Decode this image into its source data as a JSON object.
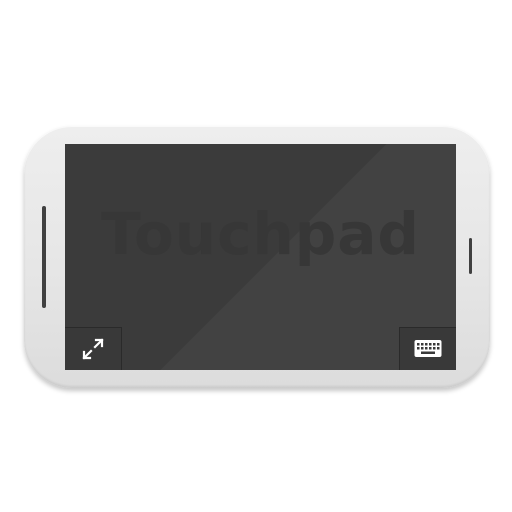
{
  "touchpad": {
    "watermark": "Touchpad"
  },
  "buttons": {
    "fullscreen": {
      "icon": "fullscreen-toggle-icon"
    },
    "keyboard": {
      "icon": "keyboard-icon"
    }
  },
  "colors": {
    "device_body": "#e6e6e6",
    "screen": "#3b3b3b",
    "icon": "#ffffff"
  }
}
